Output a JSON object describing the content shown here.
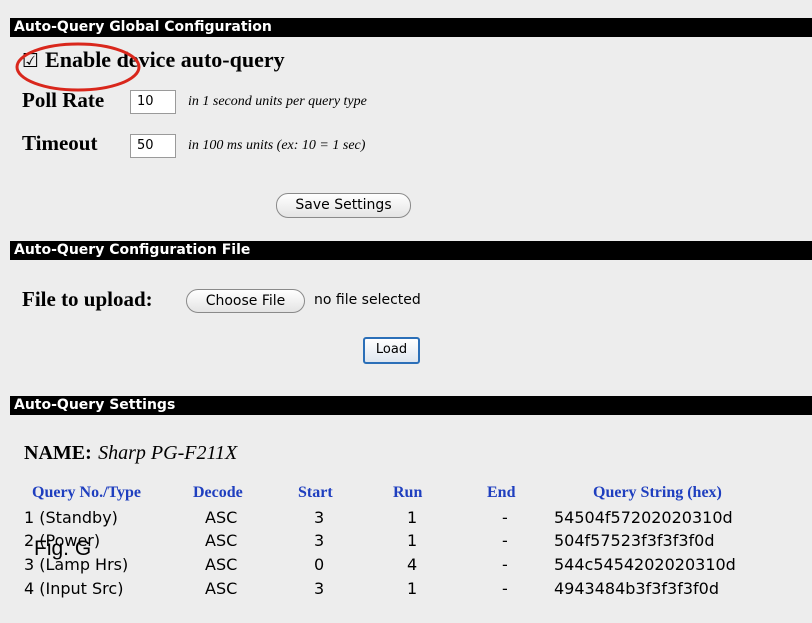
{
  "sections": {
    "global_config": "Auto-Query Global Configuration",
    "config_file": "Auto-Query Configuration File",
    "settings": "Auto-Query Settings"
  },
  "global": {
    "enable_checkbox_glyph": "☑",
    "enable_label": "Enable device auto-query",
    "enable_checked": true,
    "poll_rate_label": "Poll Rate",
    "poll_rate_value": "10",
    "poll_rate_note": "in 1 second units per query type",
    "timeout_label": "Timeout",
    "timeout_value": "50",
    "timeout_note": "in 100 ms units (ex: 10 = 1 sec)",
    "save_button": "Save Settings"
  },
  "file": {
    "label": "File to upload:",
    "choose_button": "Choose File",
    "status": "no file selected",
    "load_button": "Load"
  },
  "settings": {
    "name_label": "NAME:",
    "name_value": "Sharp PG-F211X",
    "columns": [
      "Query No./Type",
      "Decode",
      "Start",
      "Run",
      "End",
      "Query String (hex)"
    ],
    "rows": [
      [
        "1 (Standby)",
        "ASC",
        "3",
        "1",
        "-",
        "54504f57202020310d"
      ],
      [
        "2 (Power)",
        "ASC",
        "3",
        "1",
        "-",
        "504f57523f3f3f3f0d"
      ],
      [
        "3 (Lamp Hrs)",
        "ASC",
        "0",
        "4",
        "-",
        "544c5454202020310d"
      ],
      [
        "4 (Input Src)",
        "ASC",
        "3",
        "1",
        "-",
        "4943484b3f3f3f3f0d"
      ]
    ]
  },
  "overlay": {
    "fig_label": "Fig. G",
    "highlight_color": "#d9271c"
  }
}
